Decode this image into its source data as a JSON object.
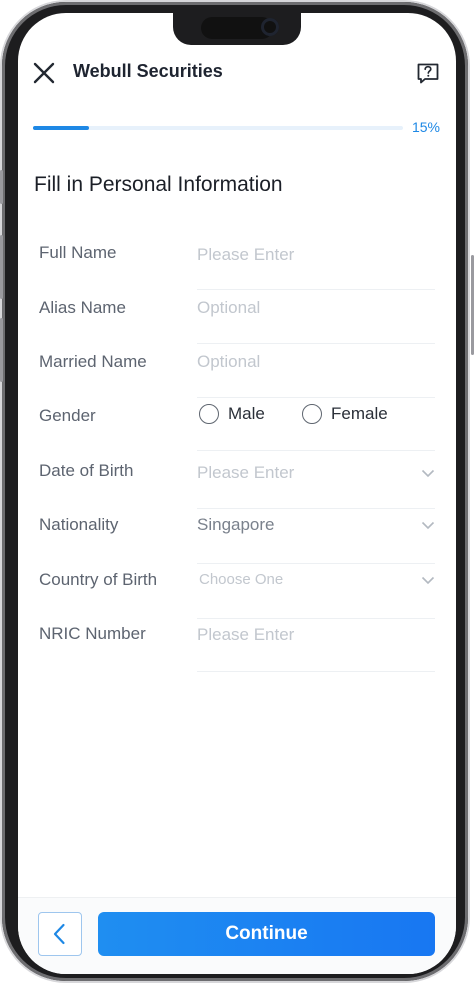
{
  "header": {
    "title": "Webull Securities",
    "close_icon": "close-icon",
    "help_icon": "help-icon"
  },
  "progress": {
    "value_percent": 15,
    "label": "15%",
    "color": "#1e88e5"
  },
  "form": {
    "title": "Fill in Personal Information",
    "full_name": {
      "label": "Full Name",
      "placeholder": "Please Enter"
    },
    "alias_name": {
      "label": "Alias Name",
      "placeholder": "Optional"
    },
    "married_name": {
      "label": "Married Name",
      "placeholder": "Optional"
    },
    "gender": {
      "label": "Gender",
      "options": [
        "Male",
        "Female"
      ]
    },
    "date_of_birth": {
      "label": "Date of Birth",
      "placeholder": "Please Enter"
    },
    "nationality": {
      "label": "Nationality",
      "value": "Singapore"
    },
    "country_of_birth": {
      "label": "Country of Birth",
      "placeholder": "Choose One"
    },
    "nric_number": {
      "label": "NRIC Number",
      "placeholder": "Please Enter"
    }
  },
  "footer": {
    "back_icon": "chevron-left-icon",
    "continue_label": "Continue",
    "accent_color": "#1877f2"
  }
}
